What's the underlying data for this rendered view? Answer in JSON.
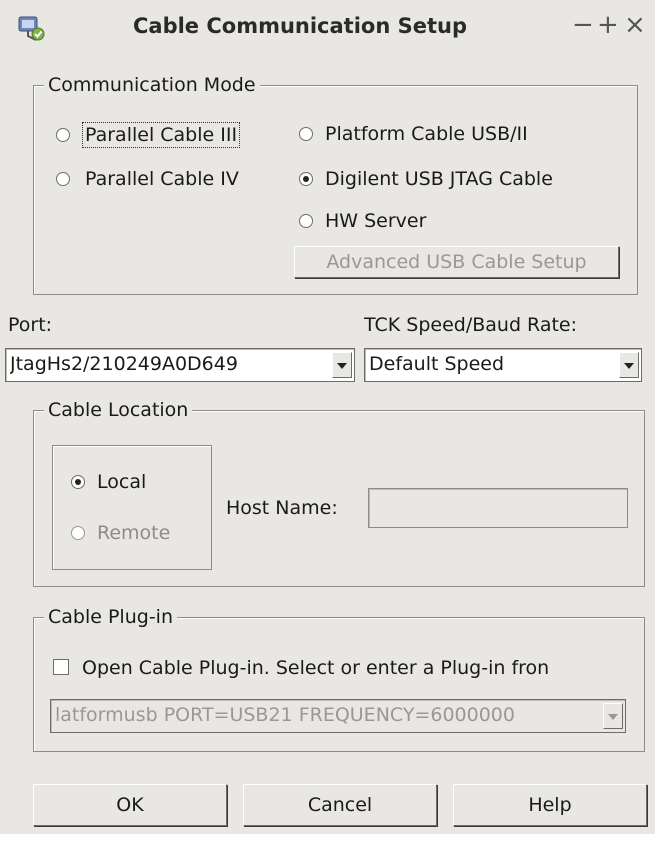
{
  "window": {
    "title": "Cable Communication Setup",
    "controls": {
      "minimize": "−",
      "maximize": "+",
      "close": "×"
    },
    "app_icon": "cable-setup-icon"
  },
  "comm_mode": {
    "legend": "Communication Mode",
    "options": [
      {
        "label": "Parallel Cable III",
        "selected": false,
        "focused": true
      },
      {
        "label": "Parallel Cable IV",
        "selected": false
      },
      {
        "label": "Platform Cable USB/II",
        "selected": false
      },
      {
        "label": "Digilent USB JTAG Cable",
        "selected": true
      },
      {
        "label": "HW Server",
        "selected": false
      }
    ],
    "advanced_button": "Advanced USB Cable Setup"
  },
  "port": {
    "label": "Port:",
    "value": "JtagHs2/210249A0D649"
  },
  "tck": {
    "label": "TCK Speed/Baud Rate:",
    "value": "Default Speed"
  },
  "cable_location": {
    "legend": "Cable Location",
    "local_label": "Local",
    "remote_label": "Remote",
    "selected": "Local",
    "host_name_label": "Host Name:",
    "host_name_value": ""
  },
  "plugin": {
    "legend": "Cable Plug-in",
    "checkbox_label": "Open Cable Plug-in. Select or enter a Plug-in fron",
    "checked": false,
    "combo_value": "latformusb PORT=USB21 FREQUENCY=6000000"
  },
  "buttons": {
    "ok": "OK",
    "cancel": "Cancel",
    "help": "Help"
  }
}
